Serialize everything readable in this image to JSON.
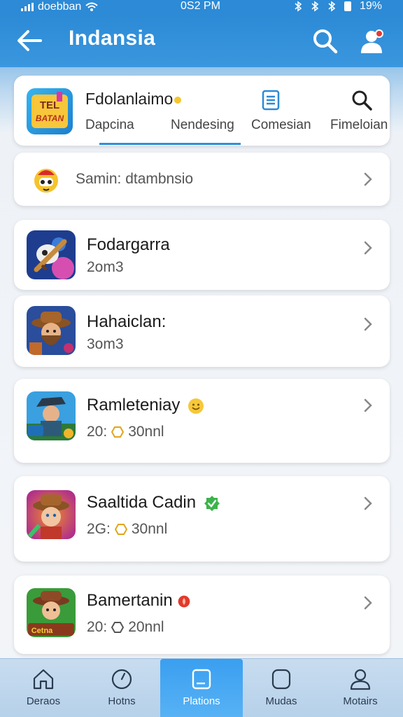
{
  "status_bar": {
    "carrier": "doebban",
    "time": "0S2 PM",
    "battery": "19%"
  },
  "app_bar": {
    "title": "Indansia"
  },
  "category_card": {
    "title": "Fdolanlaimo",
    "logo_text_top": "TEL",
    "logo_text_bottom": "BATAN",
    "tabs": [
      {
        "label": "Dapcina",
        "active": true
      },
      {
        "label": "Nendesing",
        "active": true
      },
      {
        "label": "Comesian",
        "active": false
      },
      {
        "label": "Fimeloian",
        "active": false
      }
    ]
  },
  "search_row": {
    "text": "Samin: dtambnsio"
  },
  "games": [
    {
      "name": "Fodargarra",
      "meta_left": "2om3",
      "meta_right": "",
      "has_coin": false,
      "badge": ""
    },
    {
      "name": "Hahaiclan:",
      "meta_left": "3om3",
      "meta_right": "",
      "has_coin": false,
      "badge": ""
    },
    {
      "name": "Ramleteniay",
      "meta_left": "20:",
      "meta_right": "30nnl",
      "has_coin": true,
      "badge": "smiley"
    },
    {
      "name": "Saaltida Cadin",
      "meta_left": "2G:",
      "meta_right": "30nnl",
      "has_coin": true,
      "badge": "green-check"
    },
    {
      "name": "Bamertanin",
      "meta_left": "20:",
      "meta_right": "20nnl",
      "has_coin": true,
      "badge": "red-dot",
      "icon_label": "Cetna"
    }
  ],
  "bottom_nav": {
    "items": [
      {
        "label": "Deraos",
        "icon": "home-icon",
        "active": false
      },
      {
        "label": "Hotns",
        "icon": "clock-icon",
        "active": false
      },
      {
        "label": "Plations",
        "icon": "tablet-icon",
        "active": true
      },
      {
        "label": "Mudas",
        "icon": "rounded-square-icon",
        "active": false
      },
      {
        "label": "Motairs",
        "icon": "person-icon",
        "active": false
      }
    ]
  },
  "colors": {
    "primary": "#2c8ad6",
    "active_nav": "#3a9ff0",
    "text": "#1b1b1b",
    "muted": "#555555"
  }
}
